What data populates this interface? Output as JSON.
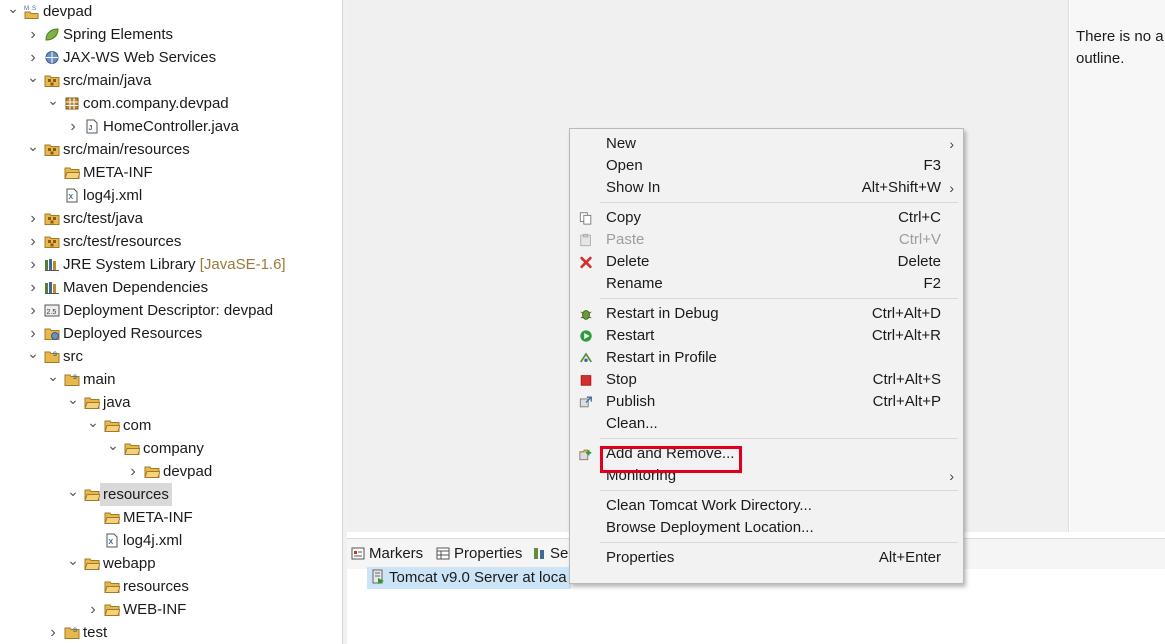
{
  "colors": {
    "highlight_box": "#e0001b",
    "selection": "#cce4f7",
    "tree_selected": "#d9d9d9",
    "folder": "#e8b94a",
    "package": "#b8872f"
  },
  "tree": {
    "items": [
      {
        "depth": 0,
        "twisty": "open",
        "icon": "maven-project-icon",
        "label": "devpad"
      },
      {
        "depth": 1,
        "twisty": "closed",
        "icon": "spring-leaf-icon",
        "label": "Spring Elements"
      },
      {
        "depth": 1,
        "twisty": "closed",
        "icon": "web-services-icon",
        "label": "JAX-WS Web Services"
      },
      {
        "depth": 1,
        "twisty": "open",
        "icon": "source-folder-icon",
        "label": "src/main/java"
      },
      {
        "depth": 2,
        "twisty": "open",
        "icon": "package-icon",
        "label": "com.company.devpad"
      },
      {
        "depth": 3,
        "twisty": "closed",
        "icon": "java-file-icon",
        "label": "HomeController.java"
      },
      {
        "depth": 1,
        "twisty": "open",
        "icon": "source-folder-icon",
        "label": "src/main/resources"
      },
      {
        "depth": 2,
        "twisty": "none",
        "icon": "folder-icon",
        "label": "META-INF"
      },
      {
        "depth": 2,
        "twisty": "none",
        "icon": "xml-file-icon",
        "label": "log4j.xml"
      },
      {
        "depth": 1,
        "twisty": "closed",
        "icon": "source-folder-icon",
        "label": "src/test/java"
      },
      {
        "depth": 1,
        "twisty": "closed",
        "icon": "source-folder-icon",
        "label": "src/test/resources"
      },
      {
        "depth": 1,
        "twisty": "closed",
        "icon": "library-icon",
        "label": "JRE System Library",
        "decoration": "[JavaSE-1.6]"
      },
      {
        "depth": 1,
        "twisty": "closed",
        "icon": "library-icon",
        "label": "Maven Dependencies"
      },
      {
        "depth": 1,
        "twisty": "closed",
        "icon": "deployment-descriptor-icon",
        "label": "Deployment Descriptor: devpad"
      },
      {
        "depth": 1,
        "twisty": "closed",
        "icon": "deployed-resources-icon",
        "label": "Deployed Resources"
      },
      {
        "depth": 1,
        "twisty": "open",
        "icon": "src-folder-icon",
        "label": "src"
      },
      {
        "depth": 2,
        "twisty": "open",
        "icon": "src-folder-icon",
        "label": "main"
      },
      {
        "depth": 3,
        "twisty": "open",
        "icon": "folder-icon",
        "label": "java"
      },
      {
        "depth": 4,
        "twisty": "open",
        "icon": "folder-icon",
        "label": "com"
      },
      {
        "depth": 5,
        "twisty": "open",
        "icon": "folder-icon",
        "label": "company"
      },
      {
        "depth": 6,
        "twisty": "closed",
        "icon": "folder-icon",
        "label": "devpad"
      },
      {
        "depth": 3,
        "twisty": "open",
        "icon": "folder-icon",
        "label": "resources",
        "selected": true
      },
      {
        "depth": 4,
        "twisty": "none",
        "icon": "folder-icon",
        "label": "META-INF"
      },
      {
        "depth": 4,
        "twisty": "none",
        "icon": "xml-file-icon",
        "label": "log4j.xml"
      },
      {
        "depth": 3,
        "twisty": "open",
        "icon": "folder-icon",
        "label": "webapp"
      },
      {
        "depth": 4,
        "twisty": "none",
        "icon": "folder-icon",
        "label": "resources"
      },
      {
        "depth": 4,
        "twisty": "closed",
        "icon": "folder-icon",
        "label": "WEB-INF"
      },
      {
        "depth": 2,
        "twisty": "closed",
        "icon": "src-folder-icon",
        "label": "test"
      }
    ]
  },
  "outline": {
    "message": "There is no a outline."
  },
  "bottom_tabs": [
    {
      "icon": "markers-icon",
      "label": "Markers"
    },
    {
      "icon": "properties-icon",
      "label": "Properties"
    },
    {
      "icon": "servers-icon",
      "label": "Se"
    }
  ],
  "servers": {
    "row_text": "Tomcat v9.0 Server at loca"
  },
  "context_menu": {
    "groups": [
      [
        {
          "label": "New",
          "shortcut": "",
          "submenu": true,
          "icon": ""
        },
        {
          "label": "Open",
          "shortcut": "F3",
          "icon": ""
        },
        {
          "label": "Show In",
          "shortcut": "Alt+Shift+W",
          "submenu": true,
          "icon": ""
        }
      ],
      [
        {
          "label": "Copy",
          "shortcut": "Ctrl+C",
          "icon": "copy-icon"
        },
        {
          "label": "Paste",
          "shortcut": "Ctrl+V",
          "icon": "paste-icon",
          "disabled": true
        },
        {
          "label": "Delete",
          "shortcut": "Delete",
          "icon": "delete-icon"
        },
        {
          "label": "Rename",
          "shortcut": "F2",
          "icon": ""
        }
      ],
      [
        {
          "label": "Restart in Debug",
          "shortcut": "Ctrl+Alt+D",
          "icon": "debug-icon"
        },
        {
          "label": "Restart",
          "shortcut": "Ctrl+Alt+R",
          "icon": "run-icon"
        },
        {
          "label": "Restart in Profile",
          "shortcut": "",
          "icon": "profile-icon"
        },
        {
          "label": "Stop",
          "shortcut": "Ctrl+Alt+S",
          "icon": "stop-icon"
        },
        {
          "label": "Publish",
          "shortcut": "Ctrl+Alt+P",
          "icon": "publish-icon"
        },
        {
          "label": "Clean...",
          "shortcut": "",
          "icon": ""
        }
      ],
      [
        {
          "label": "Add and Remove...",
          "shortcut": "",
          "icon": "add-remove-icon",
          "highlighted": true
        },
        {
          "label": "Monitoring",
          "shortcut": "",
          "submenu": true,
          "icon": ""
        }
      ],
      [
        {
          "label": "Clean Tomcat Work Directory...",
          "shortcut": "",
          "icon": ""
        },
        {
          "label": "Browse Deployment Location...",
          "shortcut": "",
          "icon": ""
        }
      ],
      [
        {
          "label": "Properties",
          "shortcut": "Alt+Enter",
          "icon": ""
        }
      ]
    ]
  }
}
